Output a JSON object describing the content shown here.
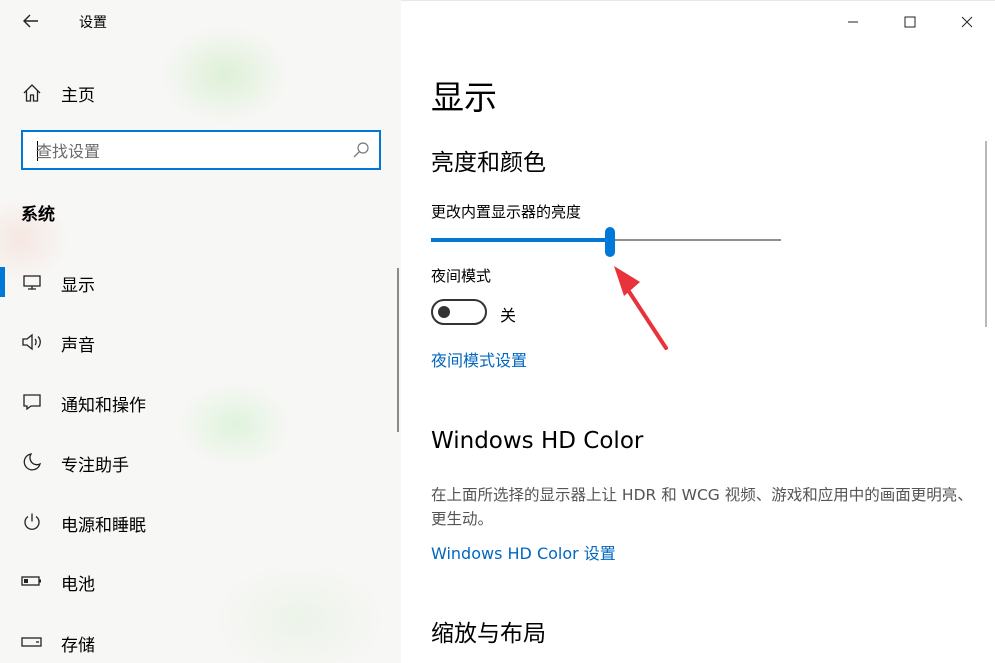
{
  "window": {
    "title": "设置",
    "back_icon": "arrow-left-icon",
    "controls": [
      "minimize-icon",
      "maximize-icon",
      "close-icon"
    ]
  },
  "sidebar": {
    "home_label": "主页",
    "search_placeholder": "查找设置",
    "section_title": "系统",
    "items": [
      {
        "label": "显示",
        "icon": "monitor-icon",
        "active": true
      },
      {
        "label": "声音",
        "icon": "speaker-icon"
      },
      {
        "label": "通知和操作",
        "icon": "notification-icon"
      },
      {
        "label": "专注助手",
        "icon": "moon-icon"
      },
      {
        "label": "电源和睡眠",
        "icon": "power-icon"
      },
      {
        "label": "电池",
        "icon": "battery-icon"
      },
      {
        "label": "存储",
        "icon": "storage-icon"
      }
    ]
  },
  "main": {
    "page_title": "显示",
    "brightness_section": {
      "heading": "亮度和颜色",
      "slider_label": "更改内置显示器的亮度",
      "brightness_level": 0.51
    },
    "night_mode": {
      "label": "夜间模式",
      "state_text": "关",
      "enabled": false,
      "settings_link": "夜间模式设置"
    },
    "hd_color": {
      "heading": "Windows HD Color",
      "description": "在上面所选择的显示器上让 HDR 和 WCG 视频、游戏和应用中的画面更明亮、更生动。",
      "settings_link": "Windows HD Color 设置"
    },
    "scale_section": {
      "heading": "缩放与布局"
    }
  },
  "colors": {
    "accent": "#0078d7",
    "link": "#0067c0",
    "annotation_arrow": "#e8323c"
  }
}
